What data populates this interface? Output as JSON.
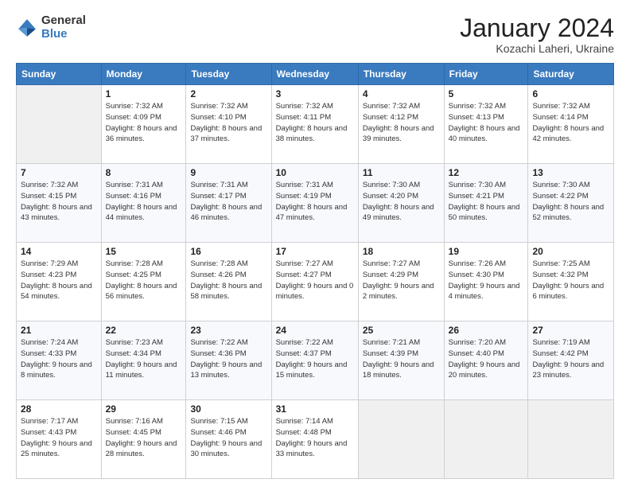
{
  "logo": {
    "general": "General",
    "blue": "Blue"
  },
  "header": {
    "title": "January 2024",
    "location": "Kozachi Laheri, Ukraine"
  },
  "days_of_week": [
    "Sunday",
    "Monday",
    "Tuesday",
    "Wednesday",
    "Thursday",
    "Friday",
    "Saturday"
  ],
  "weeks": [
    [
      {
        "day": "",
        "sunrise": "",
        "sunset": "",
        "daylight": ""
      },
      {
        "day": "1",
        "sunrise": "Sunrise: 7:32 AM",
        "sunset": "Sunset: 4:09 PM",
        "daylight": "Daylight: 8 hours and 36 minutes."
      },
      {
        "day": "2",
        "sunrise": "Sunrise: 7:32 AM",
        "sunset": "Sunset: 4:10 PM",
        "daylight": "Daylight: 8 hours and 37 minutes."
      },
      {
        "day": "3",
        "sunrise": "Sunrise: 7:32 AM",
        "sunset": "Sunset: 4:11 PM",
        "daylight": "Daylight: 8 hours and 38 minutes."
      },
      {
        "day": "4",
        "sunrise": "Sunrise: 7:32 AM",
        "sunset": "Sunset: 4:12 PM",
        "daylight": "Daylight: 8 hours and 39 minutes."
      },
      {
        "day": "5",
        "sunrise": "Sunrise: 7:32 AM",
        "sunset": "Sunset: 4:13 PM",
        "daylight": "Daylight: 8 hours and 40 minutes."
      },
      {
        "day": "6",
        "sunrise": "Sunrise: 7:32 AM",
        "sunset": "Sunset: 4:14 PM",
        "daylight": "Daylight: 8 hours and 42 minutes."
      }
    ],
    [
      {
        "day": "7",
        "sunrise": "Sunrise: 7:32 AM",
        "sunset": "Sunset: 4:15 PM",
        "daylight": "Daylight: 8 hours and 43 minutes."
      },
      {
        "day": "8",
        "sunrise": "Sunrise: 7:31 AM",
        "sunset": "Sunset: 4:16 PM",
        "daylight": "Daylight: 8 hours and 44 minutes."
      },
      {
        "day": "9",
        "sunrise": "Sunrise: 7:31 AM",
        "sunset": "Sunset: 4:17 PM",
        "daylight": "Daylight: 8 hours and 46 minutes."
      },
      {
        "day": "10",
        "sunrise": "Sunrise: 7:31 AM",
        "sunset": "Sunset: 4:19 PM",
        "daylight": "Daylight: 8 hours and 47 minutes."
      },
      {
        "day": "11",
        "sunrise": "Sunrise: 7:30 AM",
        "sunset": "Sunset: 4:20 PM",
        "daylight": "Daylight: 8 hours and 49 minutes."
      },
      {
        "day": "12",
        "sunrise": "Sunrise: 7:30 AM",
        "sunset": "Sunset: 4:21 PM",
        "daylight": "Daylight: 8 hours and 50 minutes."
      },
      {
        "day": "13",
        "sunrise": "Sunrise: 7:30 AM",
        "sunset": "Sunset: 4:22 PM",
        "daylight": "Daylight: 8 hours and 52 minutes."
      }
    ],
    [
      {
        "day": "14",
        "sunrise": "Sunrise: 7:29 AM",
        "sunset": "Sunset: 4:23 PM",
        "daylight": "Daylight: 8 hours and 54 minutes."
      },
      {
        "day": "15",
        "sunrise": "Sunrise: 7:28 AM",
        "sunset": "Sunset: 4:25 PM",
        "daylight": "Daylight: 8 hours and 56 minutes."
      },
      {
        "day": "16",
        "sunrise": "Sunrise: 7:28 AM",
        "sunset": "Sunset: 4:26 PM",
        "daylight": "Daylight: 8 hours and 58 minutes."
      },
      {
        "day": "17",
        "sunrise": "Sunrise: 7:27 AM",
        "sunset": "Sunset: 4:27 PM",
        "daylight": "Daylight: 9 hours and 0 minutes."
      },
      {
        "day": "18",
        "sunrise": "Sunrise: 7:27 AM",
        "sunset": "Sunset: 4:29 PM",
        "daylight": "Daylight: 9 hours and 2 minutes."
      },
      {
        "day": "19",
        "sunrise": "Sunrise: 7:26 AM",
        "sunset": "Sunset: 4:30 PM",
        "daylight": "Daylight: 9 hours and 4 minutes."
      },
      {
        "day": "20",
        "sunrise": "Sunrise: 7:25 AM",
        "sunset": "Sunset: 4:32 PM",
        "daylight": "Daylight: 9 hours and 6 minutes."
      }
    ],
    [
      {
        "day": "21",
        "sunrise": "Sunrise: 7:24 AM",
        "sunset": "Sunset: 4:33 PM",
        "daylight": "Daylight: 9 hours and 8 minutes."
      },
      {
        "day": "22",
        "sunrise": "Sunrise: 7:23 AM",
        "sunset": "Sunset: 4:34 PM",
        "daylight": "Daylight: 9 hours and 11 minutes."
      },
      {
        "day": "23",
        "sunrise": "Sunrise: 7:22 AM",
        "sunset": "Sunset: 4:36 PM",
        "daylight": "Daylight: 9 hours and 13 minutes."
      },
      {
        "day": "24",
        "sunrise": "Sunrise: 7:22 AM",
        "sunset": "Sunset: 4:37 PM",
        "daylight": "Daylight: 9 hours and 15 minutes."
      },
      {
        "day": "25",
        "sunrise": "Sunrise: 7:21 AM",
        "sunset": "Sunset: 4:39 PM",
        "daylight": "Daylight: 9 hours and 18 minutes."
      },
      {
        "day": "26",
        "sunrise": "Sunrise: 7:20 AM",
        "sunset": "Sunset: 4:40 PM",
        "daylight": "Daylight: 9 hours and 20 minutes."
      },
      {
        "day": "27",
        "sunrise": "Sunrise: 7:19 AM",
        "sunset": "Sunset: 4:42 PM",
        "daylight": "Daylight: 9 hours and 23 minutes."
      }
    ],
    [
      {
        "day": "28",
        "sunrise": "Sunrise: 7:17 AM",
        "sunset": "Sunset: 4:43 PM",
        "daylight": "Daylight: 9 hours and 25 minutes."
      },
      {
        "day": "29",
        "sunrise": "Sunrise: 7:16 AM",
        "sunset": "Sunset: 4:45 PM",
        "daylight": "Daylight: 9 hours and 28 minutes."
      },
      {
        "day": "30",
        "sunrise": "Sunrise: 7:15 AM",
        "sunset": "Sunset: 4:46 PM",
        "daylight": "Daylight: 9 hours and 30 minutes."
      },
      {
        "day": "31",
        "sunrise": "Sunrise: 7:14 AM",
        "sunset": "Sunset: 4:48 PM",
        "daylight": "Daylight: 9 hours and 33 minutes."
      },
      {
        "day": "",
        "sunrise": "",
        "sunset": "",
        "daylight": ""
      },
      {
        "day": "",
        "sunrise": "",
        "sunset": "",
        "daylight": ""
      },
      {
        "day": "",
        "sunrise": "",
        "sunset": "",
        "daylight": ""
      }
    ]
  ]
}
